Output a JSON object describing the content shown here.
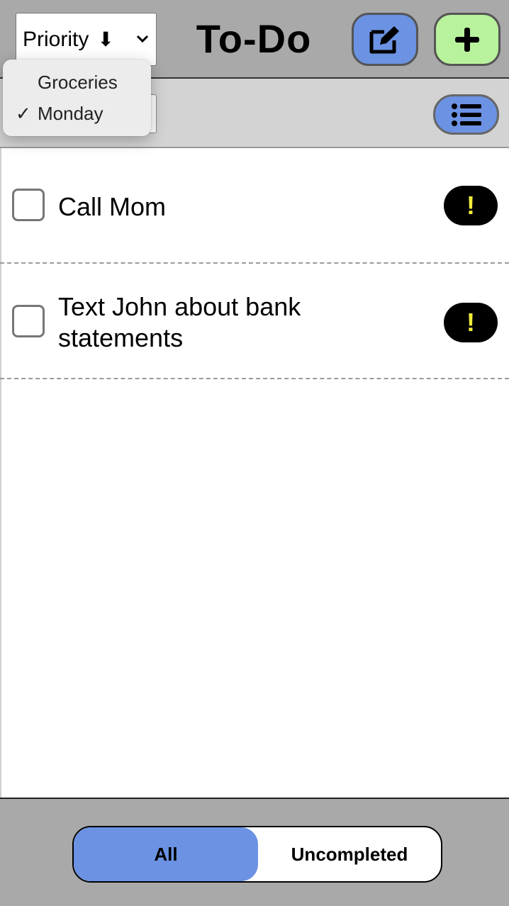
{
  "header": {
    "sort_select": {
      "value": "Priority",
      "arrow": "⬇"
    },
    "title": "To-Do",
    "edit_button": {
      "icon": "edit-icon",
      "color": "#6b92e3"
    },
    "add_button": {
      "icon": "plus-icon",
      "color": "#b9f29c"
    }
  },
  "toolbar": {
    "list_button": {
      "icon": "list-icon",
      "color": "#6b92e3"
    }
  },
  "dropdown": {
    "options": [
      {
        "label": "Groceries",
        "selected": false
      },
      {
        "label": "Monday",
        "selected": true
      }
    ],
    "check_glyph": "✓"
  },
  "tasks": [
    {
      "text": "Call Mom",
      "completed": false,
      "priority": "!"
    },
    {
      "text": "Text John about bank statements",
      "completed": false,
      "priority": "!"
    }
  ],
  "footer": {
    "filter": {
      "all_label": "All",
      "uncompleted_label": "Uncompleted",
      "active": "All",
      "active_color": "#6b92e3"
    }
  }
}
